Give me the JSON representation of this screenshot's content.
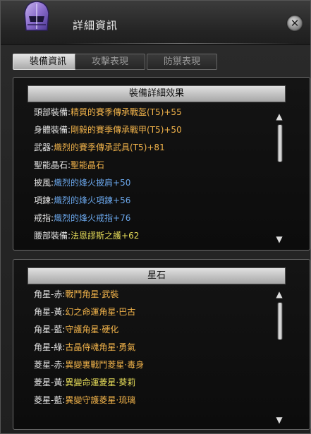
{
  "window": {
    "title": "詳細資訊",
    "close_glyph": "✕"
  },
  "tabs": [
    {
      "label": "裝備資訊",
      "active": true
    },
    {
      "label": "攻擊表現",
      "active": false
    },
    {
      "label": "防禦表現",
      "active": false
    }
  ],
  "equipment": {
    "header": "裝備詳細效果",
    "rows": [
      {
        "label": "頭部裝備:",
        "value": "精質的賽季傳承戰盔(T5)+55",
        "color": "gold"
      },
      {
        "label": "身體裝備:",
        "value": "剛毅的賽季傳承戰甲(T5)+50",
        "color": "gold"
      },
      {
        "label": "武器:",
        "value": "熾烈的賽季傳承武具(T5)+81",
        "color": "gold"
      },
      {
        "label": "聖能晶石:",
        "value": "聖能晶石",
        "color": "gold"
      },
      {
        "label": "披風:",
        "value": "熾烈的烽火披肩+50",
        "color": "blue"
      },
      {
        "label": "項鍊:",
        "value": "熾烈的烽火項鍊+56",
        "color": "blue"
      },
      {
        "label": "戒指:",
        "value": "熾烈的烽火戒指+76",
        "color": "blue"
      },
      {
        "label": "腰部裝備:",
        "value": "法恩謬斯之護+62",
        "color": "yellow"
      }
    ]
  },
  "stars": {
    "header": "星石",
    "rows": [
      {
        "label": "角星-赤:",
        "value": "戰鬥角星·武裝",
        "color": "gold"
      },
      {
        "label": "角星-黃:",
        "value": "幻之命運角星·巴古",
        "color": "gold"
      },
      {
        "label": "角星-藍:",
        "value": "守護角星·硬化",
        "color": "gold"
      },
      {
        "label": "角星-綠:",
        "value": "古晶侍魂角星·勇氣",
        "color": "gold"
      },
      {
        "label": "菱星-赤:",
        "value": "異變裏戰鬥菱星·毒身",
        "color": "gold"
      },
      {
        "label": "菱星-黃:",
        "value": "異變命運菱星·葵莉",
        "color": "yellow"
      },
      {
        "label": "菱星-藍:",
        "value": "異變守護菱星·琉璃",
        "color": "gold"
      }
    ]
  },
  "icons": {
    "helmet": "helmet-icon",
    "close": "close-icon",
    "scroll_up": "▲",
    "scroll_down": "▼"
  },
  "colors": {
    "gold": "#f0b24a",
    "blue": "#6aa6ea",
    "yellow": "#e8de5a"
  }
}
